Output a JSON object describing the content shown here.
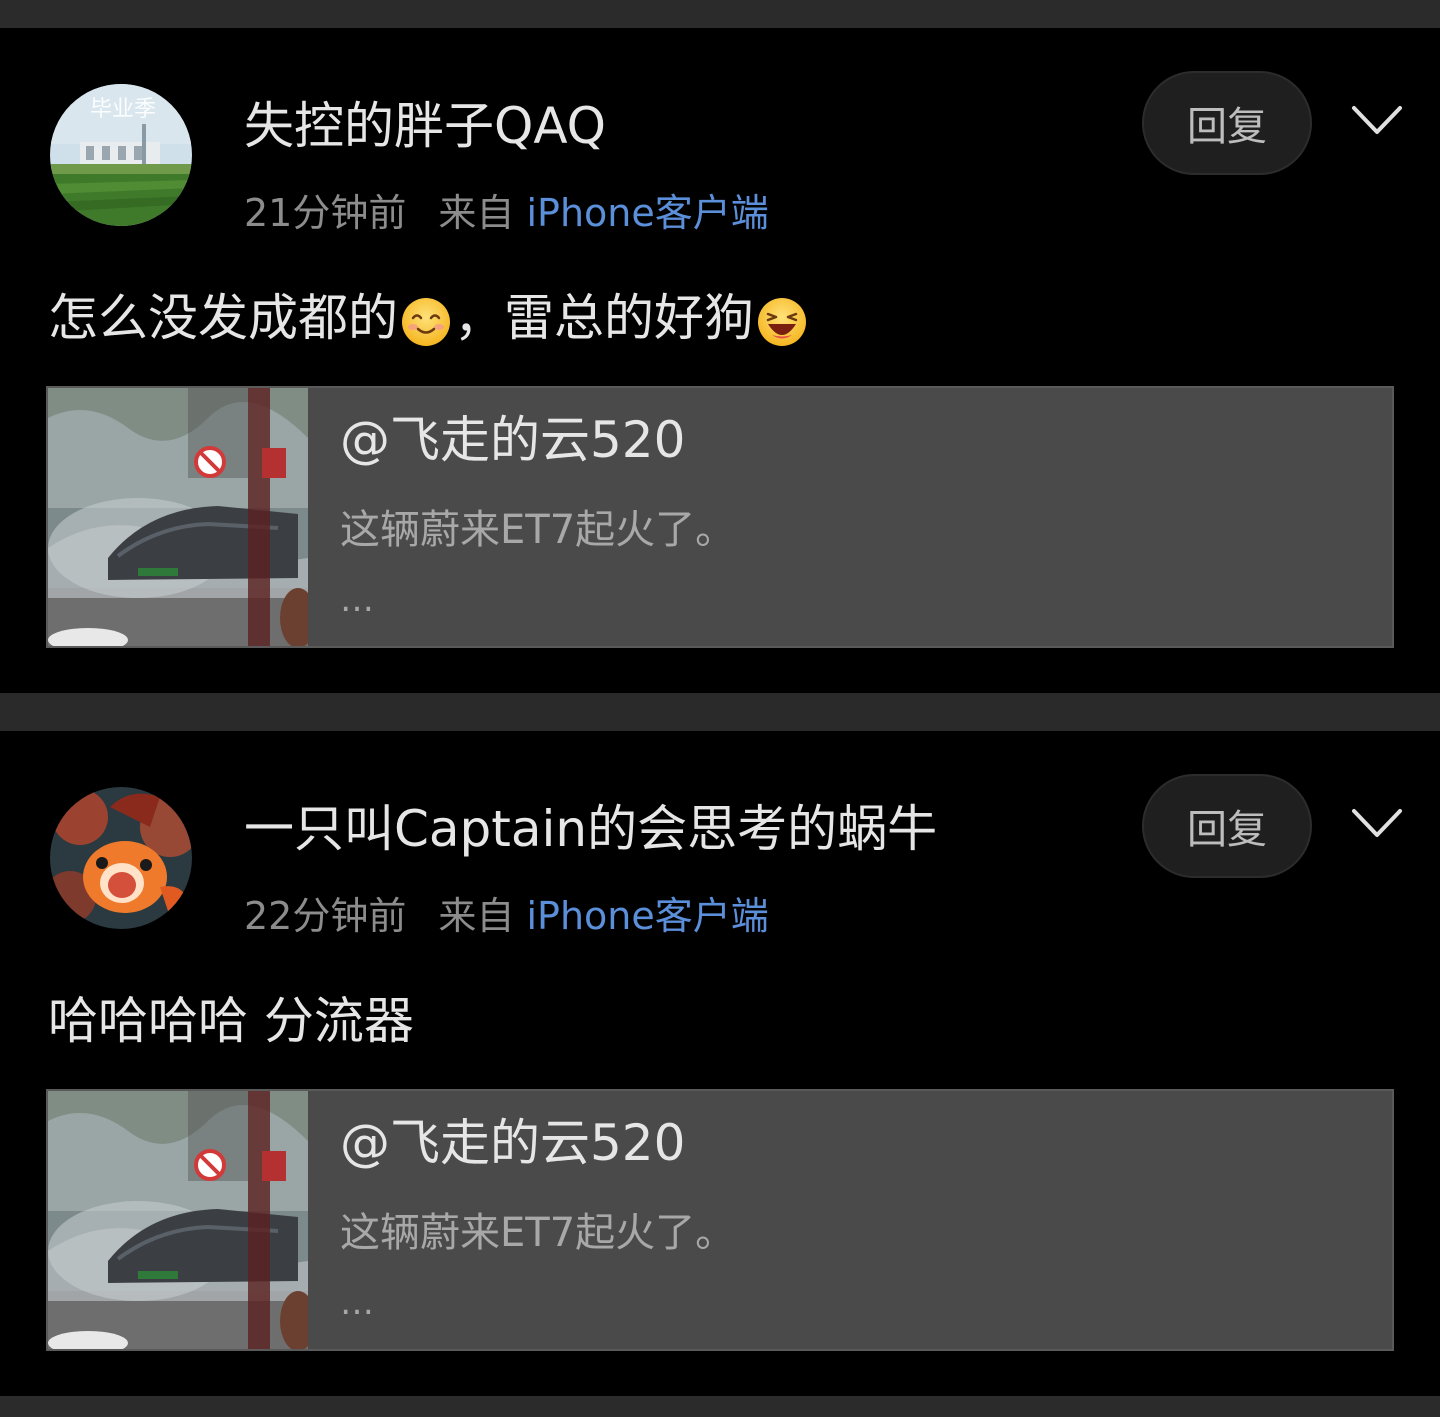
{
  "comments": [
    {
      "username": "失控的胖子QAQ",
      "time": "21分钟前",
      "from_label": "来自",
      "source": "iPhone客户端",
      "reply_label": "回复",
      "text_part1": "怎么没发成都的",
      "text_part2": "，雷总的好狗",
      "emoji1": "smile-emoji",
      "emoji2": "laugh-emoji",
      "quote": {
        "name": "@飞走的云520",
        "text": "这辆蔚来ET7起火了。",
        "more": "…"
      }
    },
    {
      "username": "一只叫Captain的会思考的蜗牛",
      "time": "22分钟前",
      "from_label": "来自",
      "source": "iPhone客户端",
      "reply_label": "回复",
      "text": "哈哈哈哈 分流器",
      "quote": {
        "name": "@飞走的云520",
        "text": "这辆蔚来ET7起火了。",
        "more": "…"
      }
    }
  ],
  "colors": {
    "background": "#000000",
    "separator": "#2a2a2a",
    "link": "#5b8fd9",
    "quote_bg": "#4a4a4a"
  }
}
